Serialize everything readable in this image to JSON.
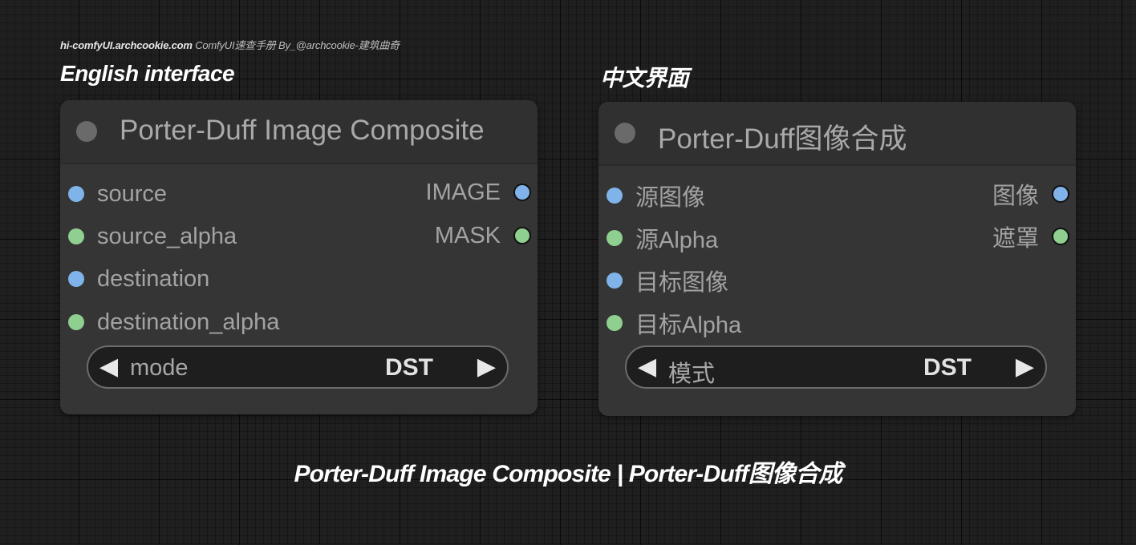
{
  "watermark": {
    "site": "hi-comfyUI.archcookie.com",
    "rest": "ComfyUI速查手册 By_@archcookie-建筑曲奇"
  },
  "labels": {
    "english": "English interface",
    "chinese": "中文界面"
  },
  "node_en": {
    "title": "Porter-Duff Image Composite",
    "inputs": [
      "source",
      "source_alpha",
      "destination",
      "destination_alpha"
    ],
    "outputs": [
      "IMAGE",
      "MASK"
    ],
    "widget": {
      "name": "mode",
      "value": "DST",
      "left_arrow": "◀",
      "right_arrow": "▶"
    }
  },
  "node_cn": {
    "title": "Porter-Duff图像合成",
    "inputs": [
      "源图像",
      "源Alpha",
      "目标图像",
      "目标Alpha"
    ],
    "outputs": [
      "图像",
      "遮罩"
    ],
    "widget": {
      "name": "模式",
      "value": "DST",
      "left_arrow": "◀",
      "right_arrow": "▶"
    }
  },
  "caption": "Porter-Duff Image Composite | Porter-Duff图像合成",
  "colors": {
    "image_slot": "#7fb3ea",
    "mask_slot": "#8fcf8f",
    "node_bg": "#353535",
    "canvas_bg": "#1f1f1f"
  }
}
